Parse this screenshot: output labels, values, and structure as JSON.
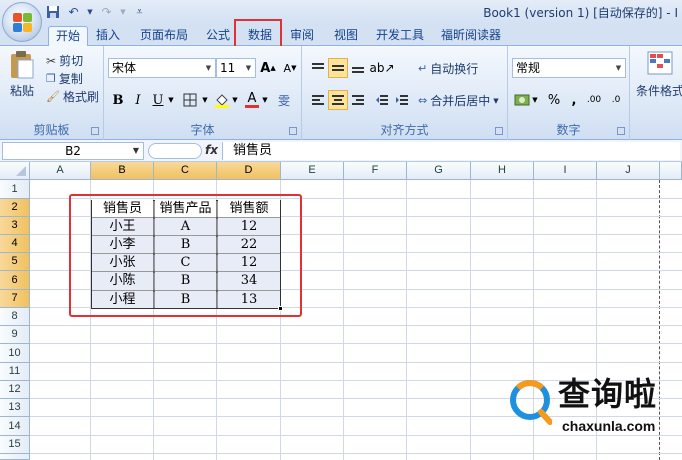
{
  "window": {
    "title": "Book1 (version 1) [自动保存的] - I"
  },
  "qat": {
    "save_icon": "save-icon",
    "undo_icon": "undo-icon",
    "redo_icon": "redo-icon",
    "customize_icon": "customize-qat-icon"
  },
  "tabs": [
    {
      "label": "开始",
      "active": true
    },
    {
      "label": "插入"
    },
    {
      "label": "页面布局"
    },
    {
      "label": "公式"
    },
    {
      "label": "数据",
      "highlighted": true
    },
    {
      "label": "审阅"
    },
    {
      "label": "视图"
    },
    {
      "label": "开发工具"
    },
    {
      "label": "福昕阅读器"
    }
  ],
  "ribbon": {
    "clipboard": {
      "paste": "粘贴",
      "cut": "剪切",
      "copy": "复制",
      "format_painter": "格式刷",
      "label": "剪贴板"
    },
    "font": {
      "font_name": "宋体",
      "font_size": "11",
      "bold": "B",
      "italic": "I",
      "underline": "U",
      "font_color_glyph": "A",
      "grow": "A",
      "shrink": "A",
      "phonetic": "雯",
      "label": "字体"
    },
    "alignment": {
      "wrap_text": "自动换行",
      "merge_center": "合并后居中",
      "label": "对齐方式"
    },
    "number": {
      "format": "常规",
      "percent": "%",
      "comma": ",",
      "inc_decimal": ".00",
      "dec_decimal": ".0",
      "label": "数字"
    },
    "styles": {
      "conditional_format": "条件格式"
    }
  },
  "formula_bar": {
    "name_box": "B2",
    "fx": "fx",
    "value": "销售员"
  },
  "sheet": {
    "columns": [
      "A",
      "B",
      "C",
      "D",
      "E",
      "F",
      "G",
      "H",
      "I",
      "J"
    ],
    "rows": [
      "1",
      "2",
      "3",
      "4",
      "5",
      "6",
      "7",
      "8",
      "9",
      "10",
      "11",
      "12",
      "13",
      "14",
      "15"
    ],
    "table": {
      "headers": [
        "销售员",
        "销售产品",
        "销售额"
      ],
      "rows": [
        [
          "小王",
          "A",
          "12"
        ],
        [
          "小李",
          "B",
          "22"
        ],
        [
          "小张",
          "C",
          "12"
        ],
        [
          "小陈",
          "B",
          "34"
        ],
        [
          "小程",
          "B",
          "13"
        ]
      ]
    }
  },
  "watermark": {
    "brand": "查询啦",
    "domain": "chaxunla.com"
  },
  "colors": {
    "accent_red": "#e03232",
    "selected_header": "#f1c15f",
    "ribbon_bg": "#dbe7f6",
    "logo_blue": "#1f8fe0",
    "logo_orange": "#f59a1a"
  }
}
